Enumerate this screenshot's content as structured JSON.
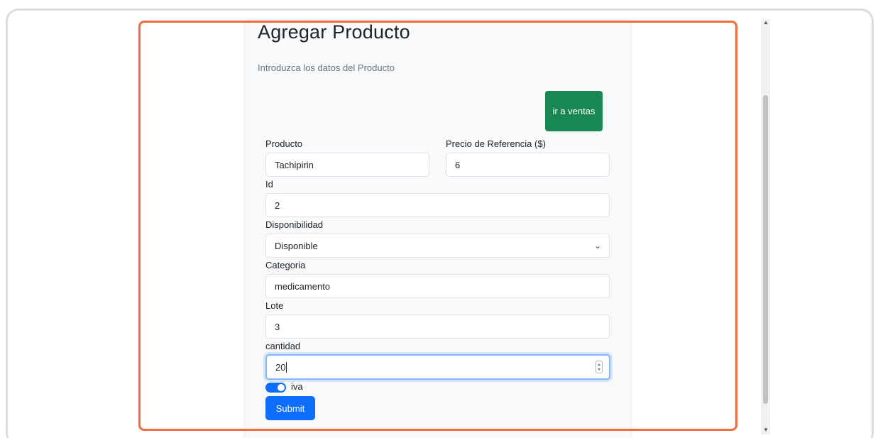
{
  "form": {
    "title": "Agregar Producto",
    "subtitle": "Introduzca los datos del Producto",
    "go_sales_button": "ir a ventas",
    "fields": {
      "producto": {
        "label": "Producto",
        "value": "Tachipirin"
      },
      "precio": {
        "label": "Precio de Referencia ($)",
        "value": "6"
      },
      "id": {
        "label": "Id",
        "value": "2"
      },
      "disponibilidad": {
        "label": "Disponibilidad",
        "value": "Disponible"
      },
      "categoria": {
        "label": "Categoria",
        "value": "medicamento"
      },
      "lote": {
        "label": "Lote",
        "value": "3"
      },
      "cantidad": {
        "label": "cantidad",
        "value": "20"
      }
    },
    "iva": {
      "label": "iva",
      "checked": true
    },
    "submit_label": "Submit"
  },
  "icons": {
    "select_chevron": "chevron-down-icon",
    "number_spinner": "spinner-icon",
    "scroll_up": "arrow-up-icon",
    "scroll_down": "arrow-down-icon"
  },
  "colors": {
    "green_button": "#198754",
    "primary": "#0d6efd",
    "highlight": "#f26b3a"
  }
}
